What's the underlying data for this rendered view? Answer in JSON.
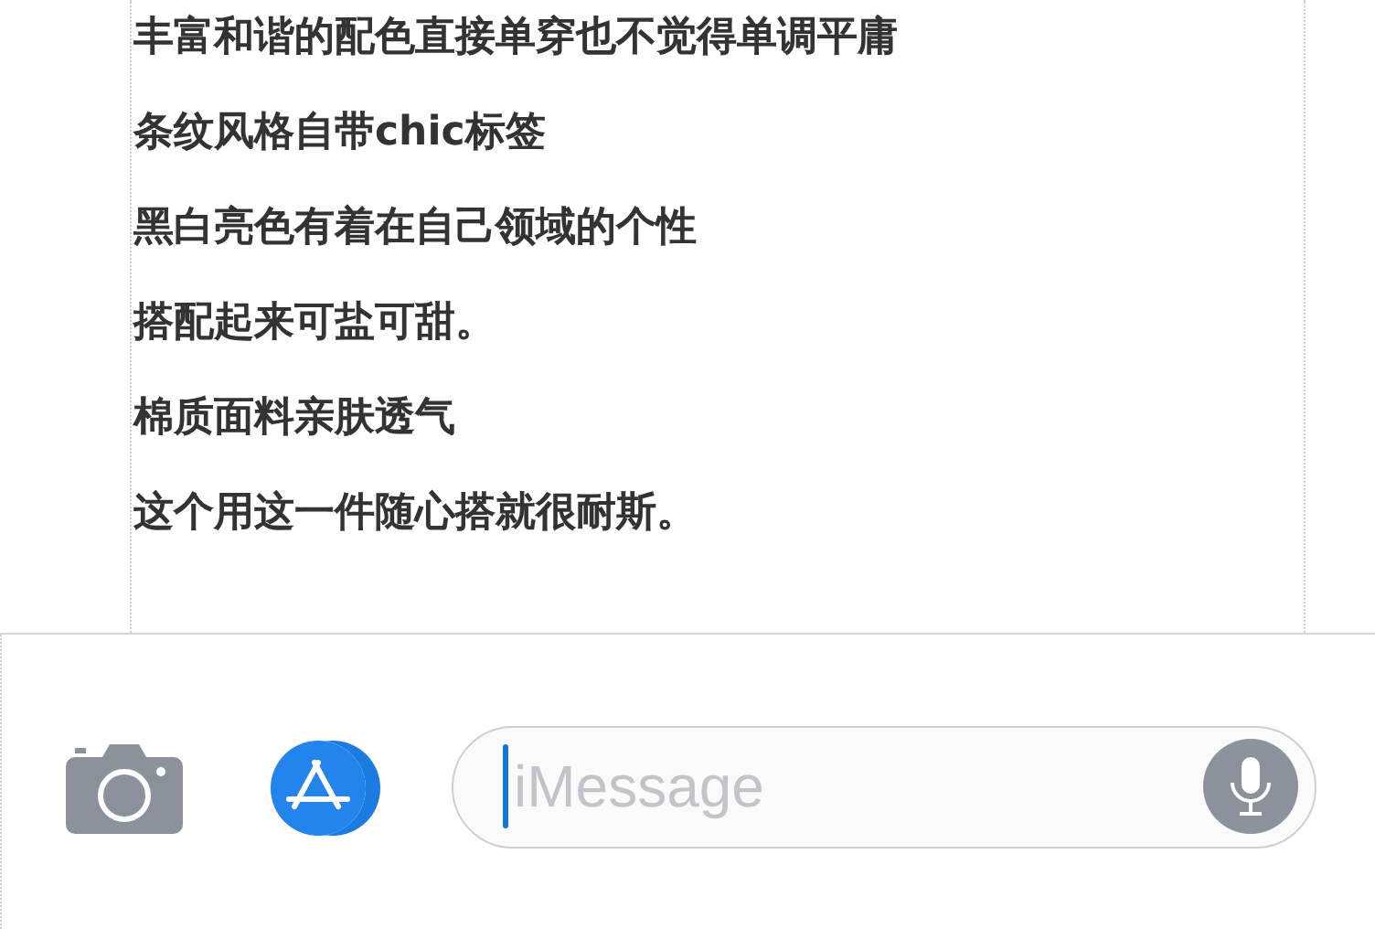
{
  "article": {
    "lines": [
      "丰富和谐的配色直接单穿也不觉得单调平庸",
      "条纹风格自带chic标签",
      "黑白亮色有着在自己领域的个性",
      "搭配起来可盐可甜。",
      "棉质面料亲肤透气",
      "这个用这一件随心搭就很耐斯。"
    ]
  },
  "compose_bar": {
    "message_field": {
      "placeholder": "iMessage"
    }
  }
}
